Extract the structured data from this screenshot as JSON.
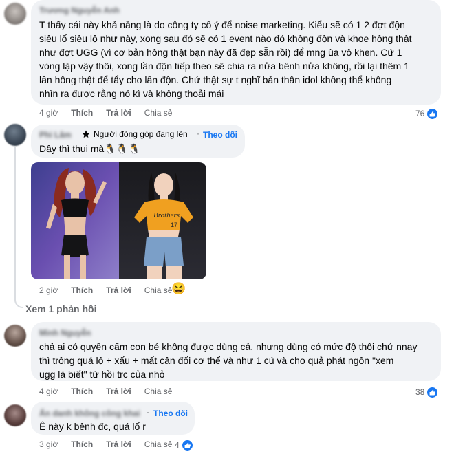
{
  "actions": {
    "like": "Thích",
    "reply": "Trả lời",
    "share": "Chia sẻ"
  },
  "colors": {
    "link": "#1877f2",
    "secondary": "#65676b",
    "bubble": "#f0f2f5"
  },
  "comments": [
    {
      "author": "Trương Nguyễn Anh",
      "lines": [
        "T thấy cái này khả năng là do công ty cố ý để noise marketing. Kiểu sẽ có 1 2 đợt độn",
        "siêu lố siêu lộ như này, xong sau đó sẽ có 1 event nào đó không độn và khoe hông thật",
        "như đợt UGG (vì cơ bản hông thật bạn này đã đẹp sẵn rồi) để mng ùa vô khen. Cứ 1",
        "vòng lặp vậy thôi, xong lần độn tiếp theo sẽ chia ra nửa bênh nửa không, rồi lại thêm 1",
        "lần hông thật để tẩy cho lần độn. Chứ thật sự t nghĩ bản thân idol không thể không",
        "nhìn ra được rằng nó kì và không thoải mái"
      ],
      "time": "4 giờ",
      "reactions": "76",
      "reaction_icon": "like-icon"
    },
    {
      "author": "Phi Lâm",
      "badge": "Người đóng góp đang lên",
      "badge_icon": "star-icon",
      "follow": "Theo dõi",
      "lines": [
        "Dậy thì thui mà🐧🐧🐧"
      ],
      "time": "2 giờ",
      "emoji_react": "😆",
      "view_replies": "Xem 1 phản hồi"
    },
    {
      "author": "Minh Nguyễn",
      "lines": [
        "chả ai có quyền cấm con bé không được dùng cả. nhưng dùng có mức độ thôi chứ nnay",
        "thì trông quá lộ + xấu + mất cân đối cơ thể và như 1 cú và cho quả phát ngôn \"xem",
        "ugg là biết\" từ hồi trc của nhỏ"
      ],
      "time": "4 giờ",
      "reactions": "38",
      "reaction_icon": "like-icon"
    },
    {
      "author": "Ẩn danh không công khai",
      "follow": "Theo dõi",
      "lines": [
        "Ê này k bênh đc, quá lố r"
      ],
      "time": "3 giờ",
      "reactions": "4",
      "reaction_icon": "like-icon"
    }
  ]
}
